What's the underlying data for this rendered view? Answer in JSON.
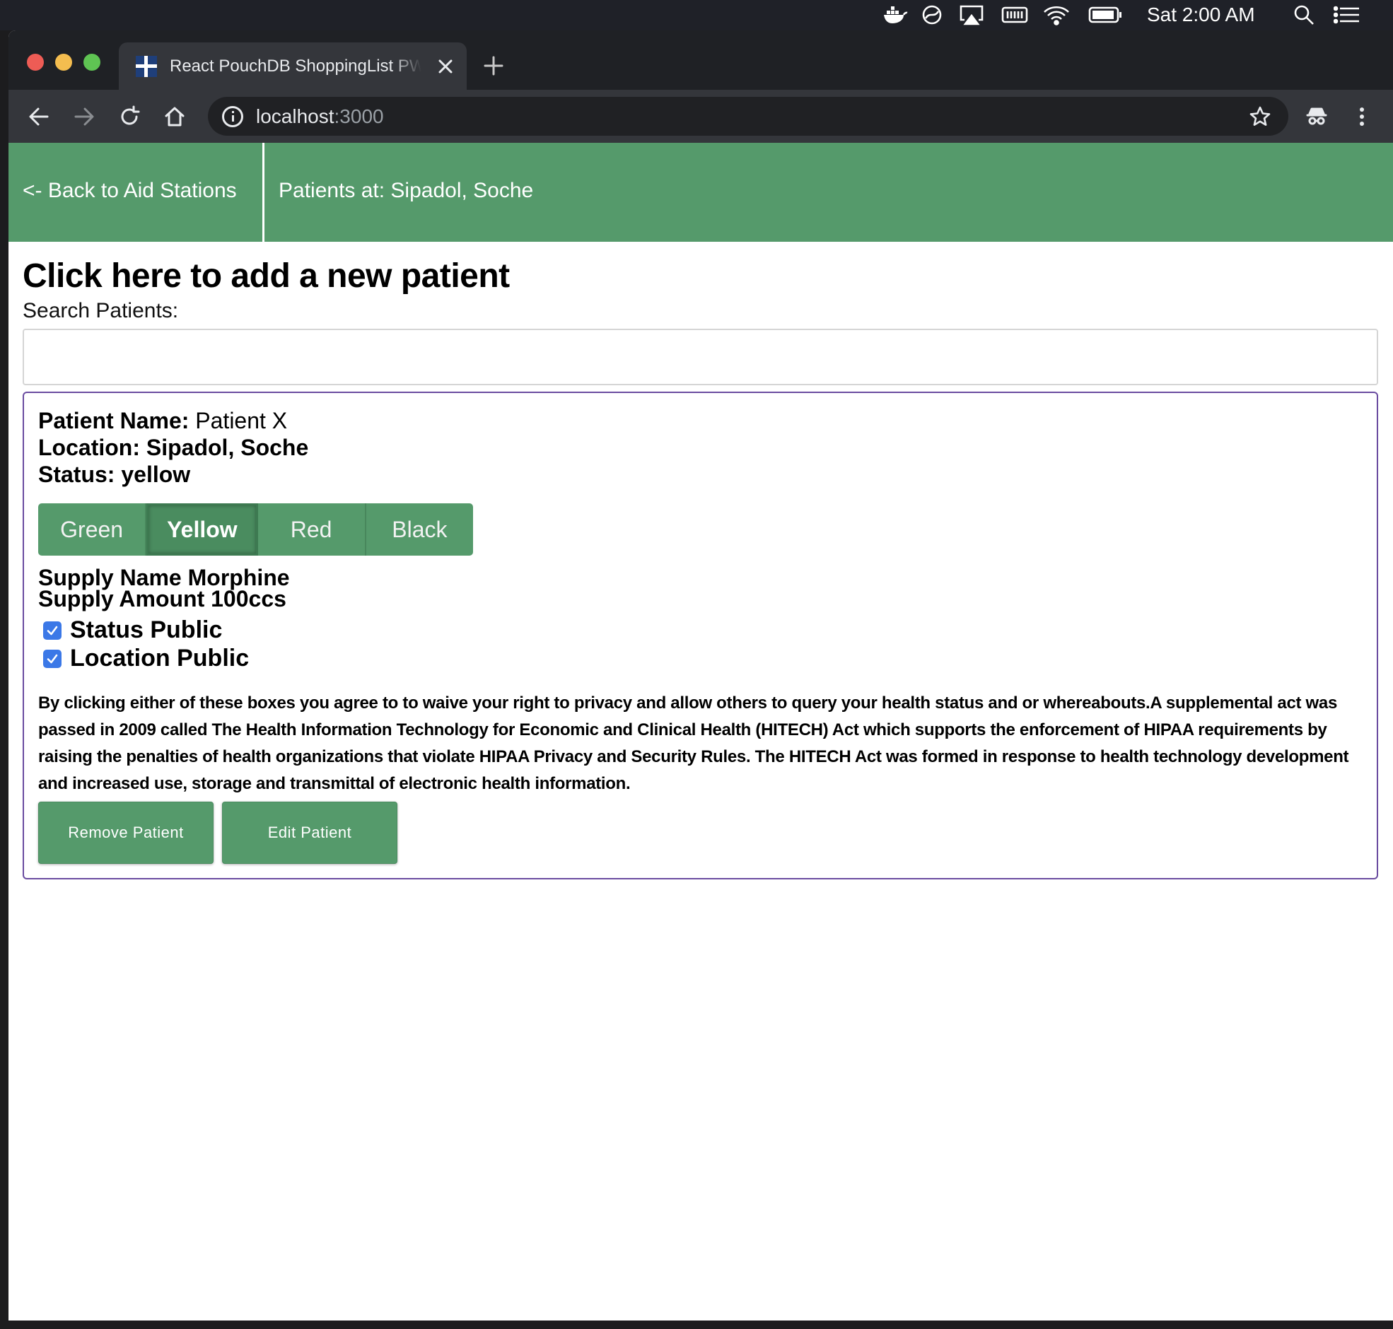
{
  "menubar": {
    "clock": "Sat 2:00 AM",
    "icons": [
      "docker-icon",
      "sync-icon",
      "airplay-icon",
      "memory-icon",
      "wifi-icon",
      "battery-icon",
      "spotlight-search-icon",
      "control-center-list-icon"
    ]
  },
  "browser": {
    "tab": {
      "title": "React PouchDB ShoppingList PWA",
      "favicon": "flag-icon"
    },
    "address": {
      "host": "localhost",
      "port": ":3000"
    },
    "colors": {
      "tabstrip": "#1f2125",
      "toolbar": "#34363b",
      "omnibox": "#202124"
    }
  },
  "app": {
    "colors": {
      "primary": "#559a6b",
      "card_border": "#6a4ca0",
      "checkbox": "#3b78e7"
    },
    "header": {
      "back_label": "<- Back to Aid Stations",
      "title": "Patients at: Sipadol, Soche"
    },
    "add_patient_label": "Click here to add a new patient",
    "search": {
      "label": "Search Patients:",
      "value": "",
      "placeholder": ""
    },
    "patient": {
      "name_label": "Patient Name:",
      "name_value": "Patient X",
      "location_line": "Location: Sipadol, Soche",
      "status_line": "Status: yellow",
      "status_options": [
        {
          "label": "Green",
          "active": false
        },
        {
          "label": "Yellow",
          "active": true
        },
        {
          "label": "Red",
          "active": false
        },
        {
          "label": "Black",
          "active": false
        }
      ],
      "supply_name_line": "Supply Name Morphine",
      "supply_amount_line": "Supply Amount 100ccs",
      "checkboxes": [
        {
          "label": "Status Public",
          "checked": true
        },
        {
          "label": "Location Public",
          "checked": true
        }
      ],
      "disclaimer": "By clicking either of these boxes you agree to to waive your right to privacy and allow others to query your health status and or whereabouts.A supplemental act was passed in 2009 called The Health Information Technology for Economic and Clinical Health (HITECH) Act which supports the enforcement of HIPAA requirements by raising the penalties of health organizations that violate HIPAA Privacy and Security Rules. The HITECH Act was formed in response to health technology development and increased use, storage and transmittal of electronic health information.",
      "remove_label": "Remove Patient",
      "edit_label": "Edit Patient"
    }
  }
}
